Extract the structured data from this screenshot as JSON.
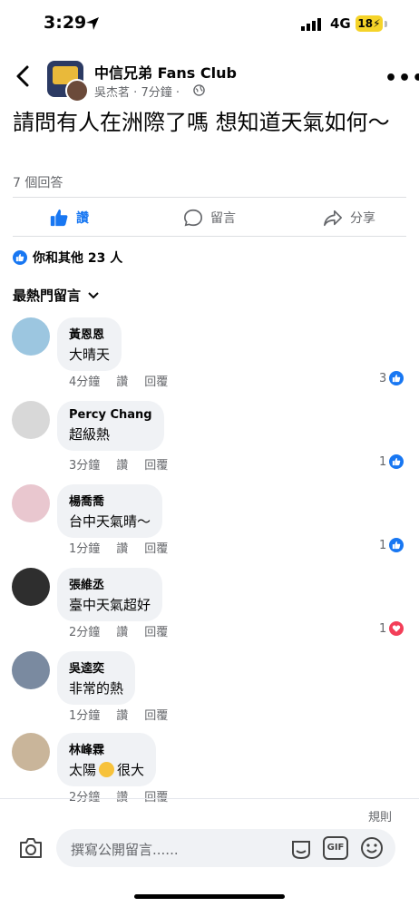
{
  "status_bar": {
    "time": "3:29",
    "network": "4G",
    "battery": "18"
  },
  "header": {
    "group_name": "中信兄弟 Fans Club",
    "author": "吳杰茗",
    "time_ago": "7分鐘",
    "dot": "·"
  },
  "post": {
    "text": "請問有人在洲際了嗎 想知道天氣如何～",
    "answers": "7 個回答"
  },
  "actions": {
    "like": "讚",
    "comment": "留言",
    "share": "分享"
  },
  "reactions_summary": "你和其他 23 人",
  "sort_label": "最熱門留言",
  "comments": [
    {
      "name": "黃恩恩",
      "text": "大晴天",
      "time": "4分鐘",
      "like": "讚",
      "reply": "回覆",
      "count": "3",
      "reaction": "like",
      "avatar_color": "#9cc6e0"
    },
    {
      "name": "Percy Chang",
      "text": "超級熱",
      "time": "3分鐘",
      "like": "讚",
      "reply": "回覆",
      "count": "1",
      "reaction": "like",
      "avatar_color": "#d8d8d8"
    },
    {
      "name": "楊喬喬",
      "text": "台中天氣晴～",
      "time": "1分鐘",
      "like": "讚",
      "reply": "回覆",
      "count": "1",
      "reaction": "like",
      "avatar_color": "#e9c7cf"
    },
    {
      "name": "張維丞",
      "text": "臺中天氣超好",
      "time": "2分鐘",
      "like": "讚",
      "reply": "回覆",
      "count": "1",
      "reaction": "love",
      "avatar_color": "#2e2e2e"
    },
    {
      "name": "吳逵奕",
      "text": "非常的熱",
      "time": "1分鐘",
      "like": "讚",
      "reply": "回覆",
      "count": "",
      "reaction": "",
      "avatar_color": "#7a8aa0"
    },
    {
      "name": "林峰霖",
      "text_before": "太陽",
      "text_after": "很大",
      "time": "2分鐘",
      "like": "讚",
      "reply": "回覆",
      "count": "",
      "reaction": "",
      "avatar_color": "#c9b59a"
    }
  ],
  "footer": {
    "rules": "規則",
    "placeholder": "撰寫公開留言......",
    "gif": "GIF"
  },
  "colors": {
    "accent": "#1877f2",
    "love": "#f33e58",
    "muted": "#65676b",
    "bubble": "#f0f2f5"
  }
}
